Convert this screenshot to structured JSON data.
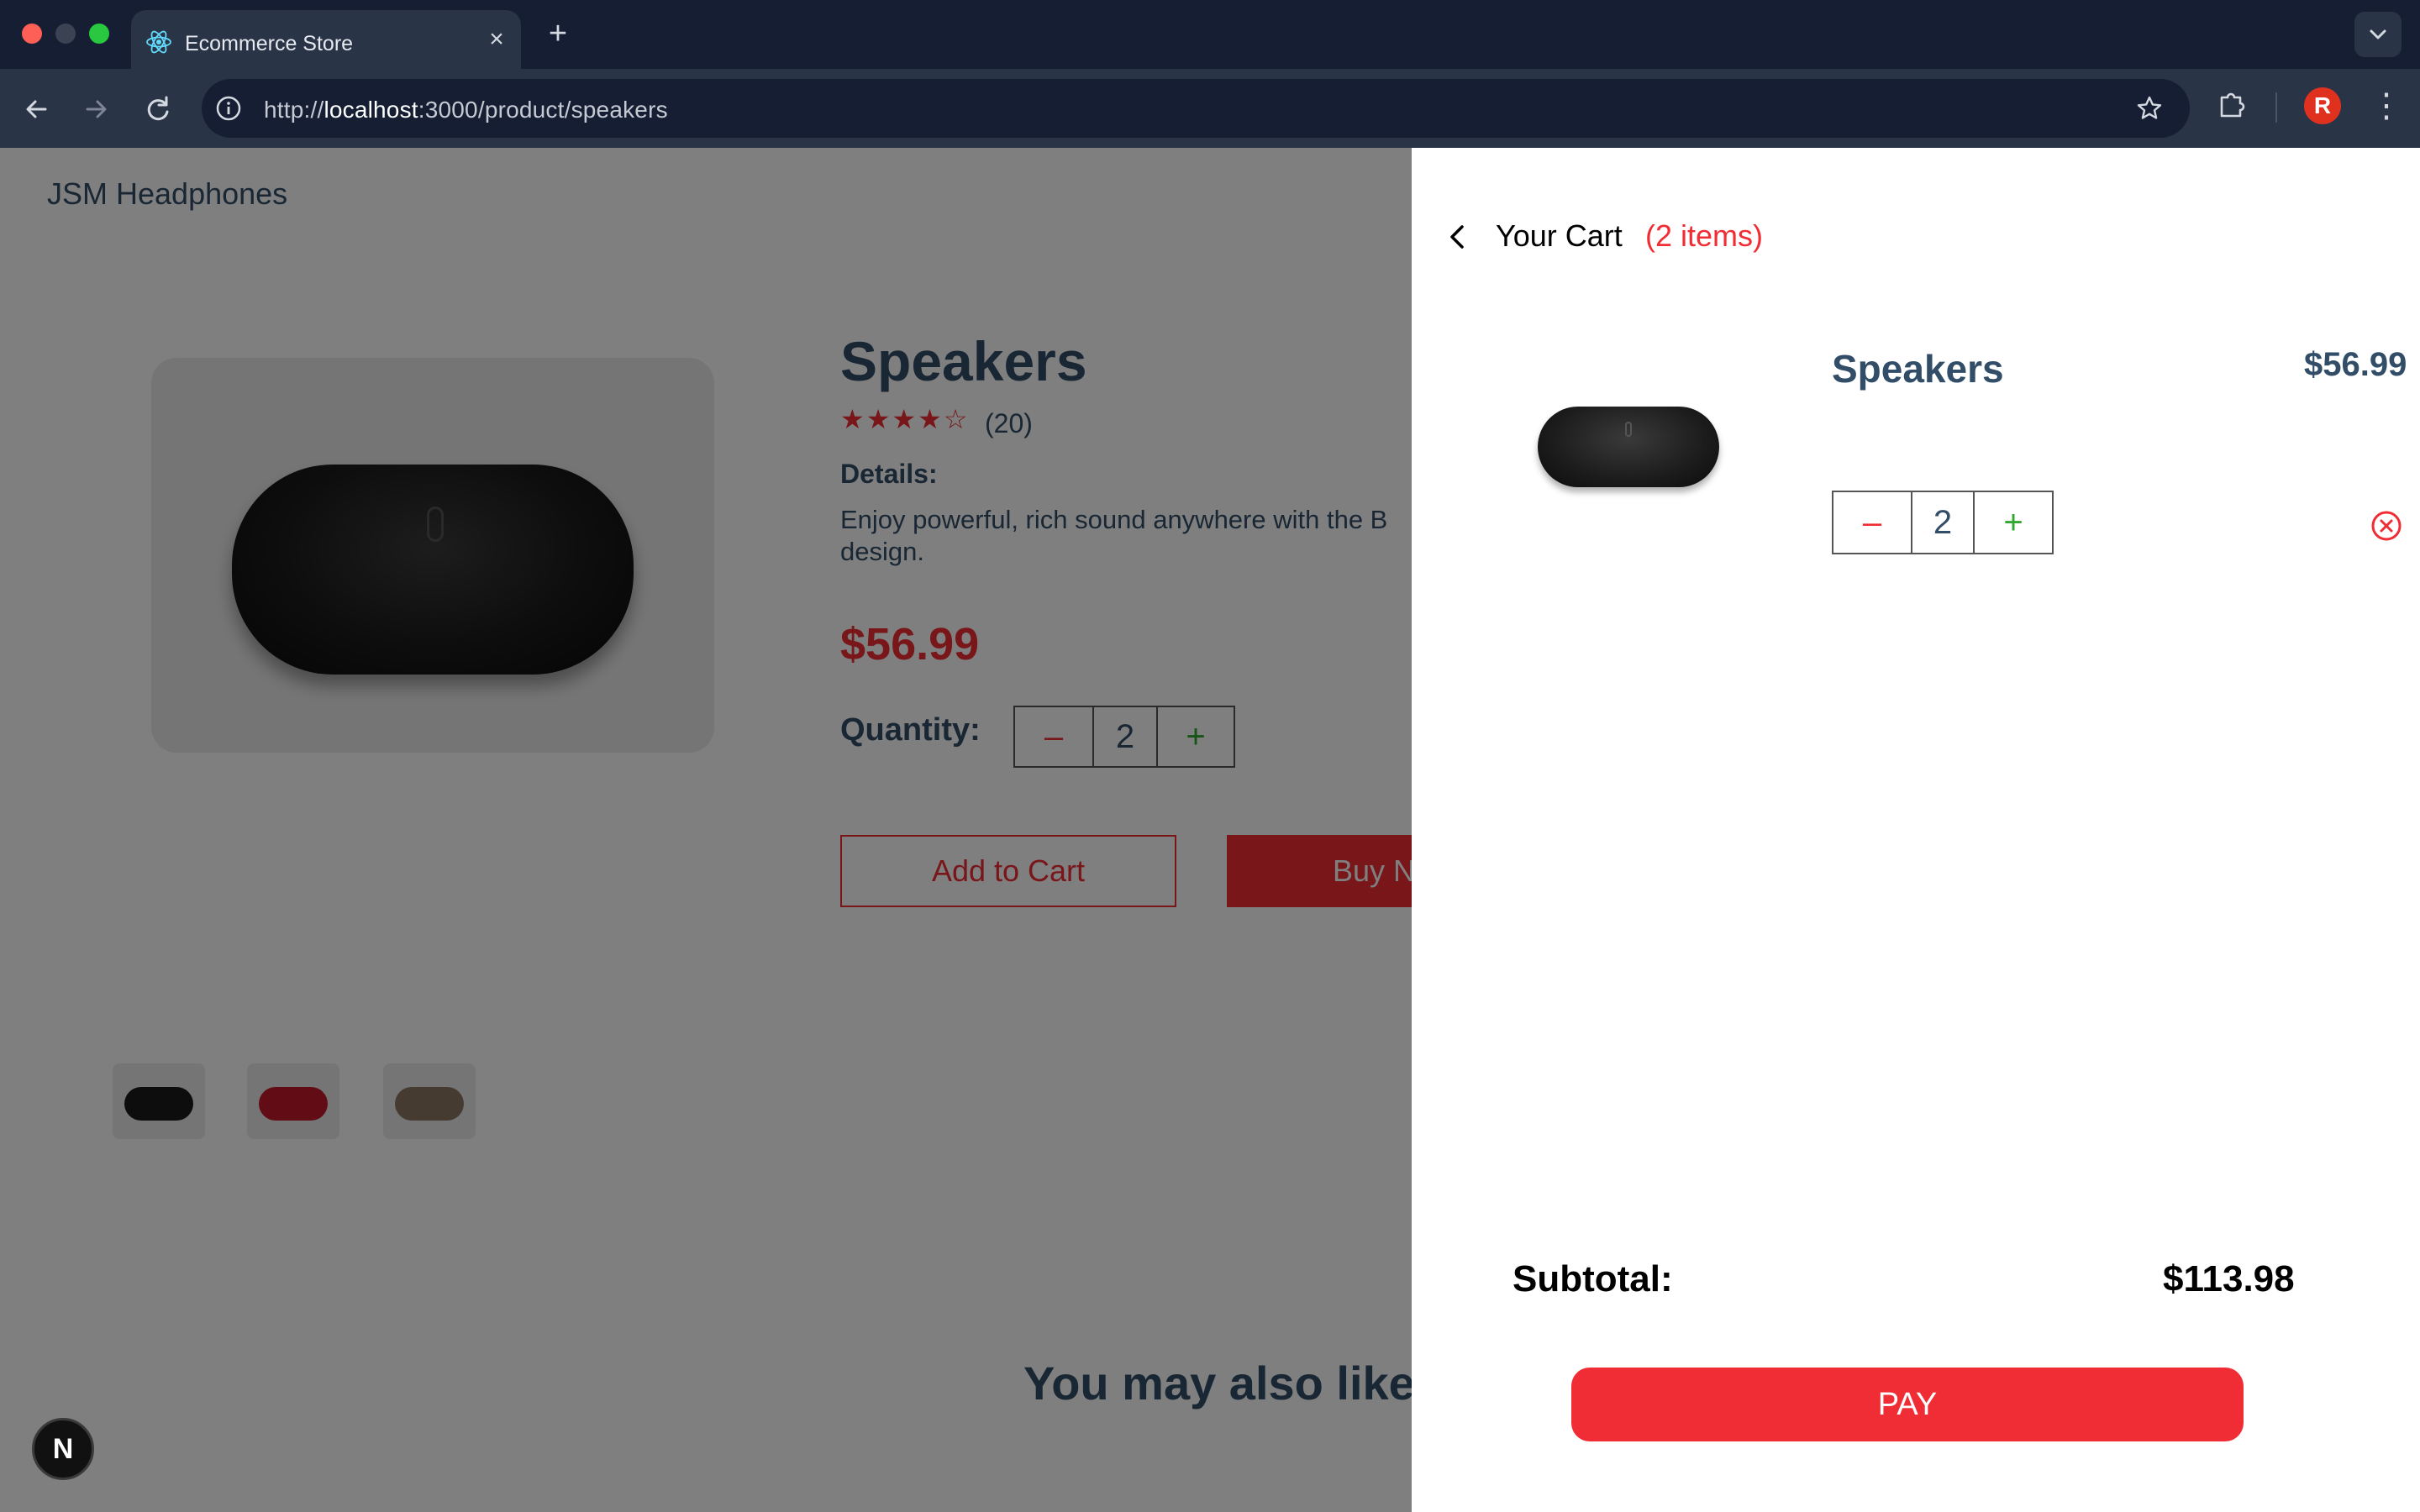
{
  "browser": {
    "tab_title": "Ecommerce Store",
    "new_tab_symbol": "+",
    "url_prefix": "http://",
    "url_host": "localhost",
    "url_rest": ":3000/product/speakers",
    "profile_initial": "R"
  },
  "store": {
    "brand": "JSM Headphones"
  },
  "product": {
    "title": "Speakers",
    "rating": 4,
    "rating_max": 5,
    "stars": "★★★★☆",
    "reviews": "(20)",
    "details_heading": "Details:",
    "details_text": "Enjoy powerful, rich sound anywhere with the B",
    "details_text_line2": "design.",
    "price": "$56.99",
    "quantity_label": "Quantity:",
    "quantity": "2",
    "minus": "–",
    "plus": "+",
    "add_to_cart": "Add to Cart",
    "buy_now": "Buy N",
    "colors": [
      "#1b1b1b",
      "#c5192d",
      "#8a7663"
    ]
  },
  "related": {
    "heading": "You may also like"
  },
  "next_badge": "N",
  "cart": {
    "title": "Your Cart",
    "count": "(2 items)",
    "items": [
      {
        "name": "Speakers",
        "price": "$56.99",
        "quantity": "2",
        "minus": "–",
        "plus": "+"
      }
    ],
    "subtotal_label": "Subtotal:",
    "subtotal_value": "$113.98",
    "pay_label": "PAY"
  },
  "colors": {
    "accent": "#f02d34",
    "text_dark": "#324d67",
    "chrome_bg": "#151e32"
  }
}
